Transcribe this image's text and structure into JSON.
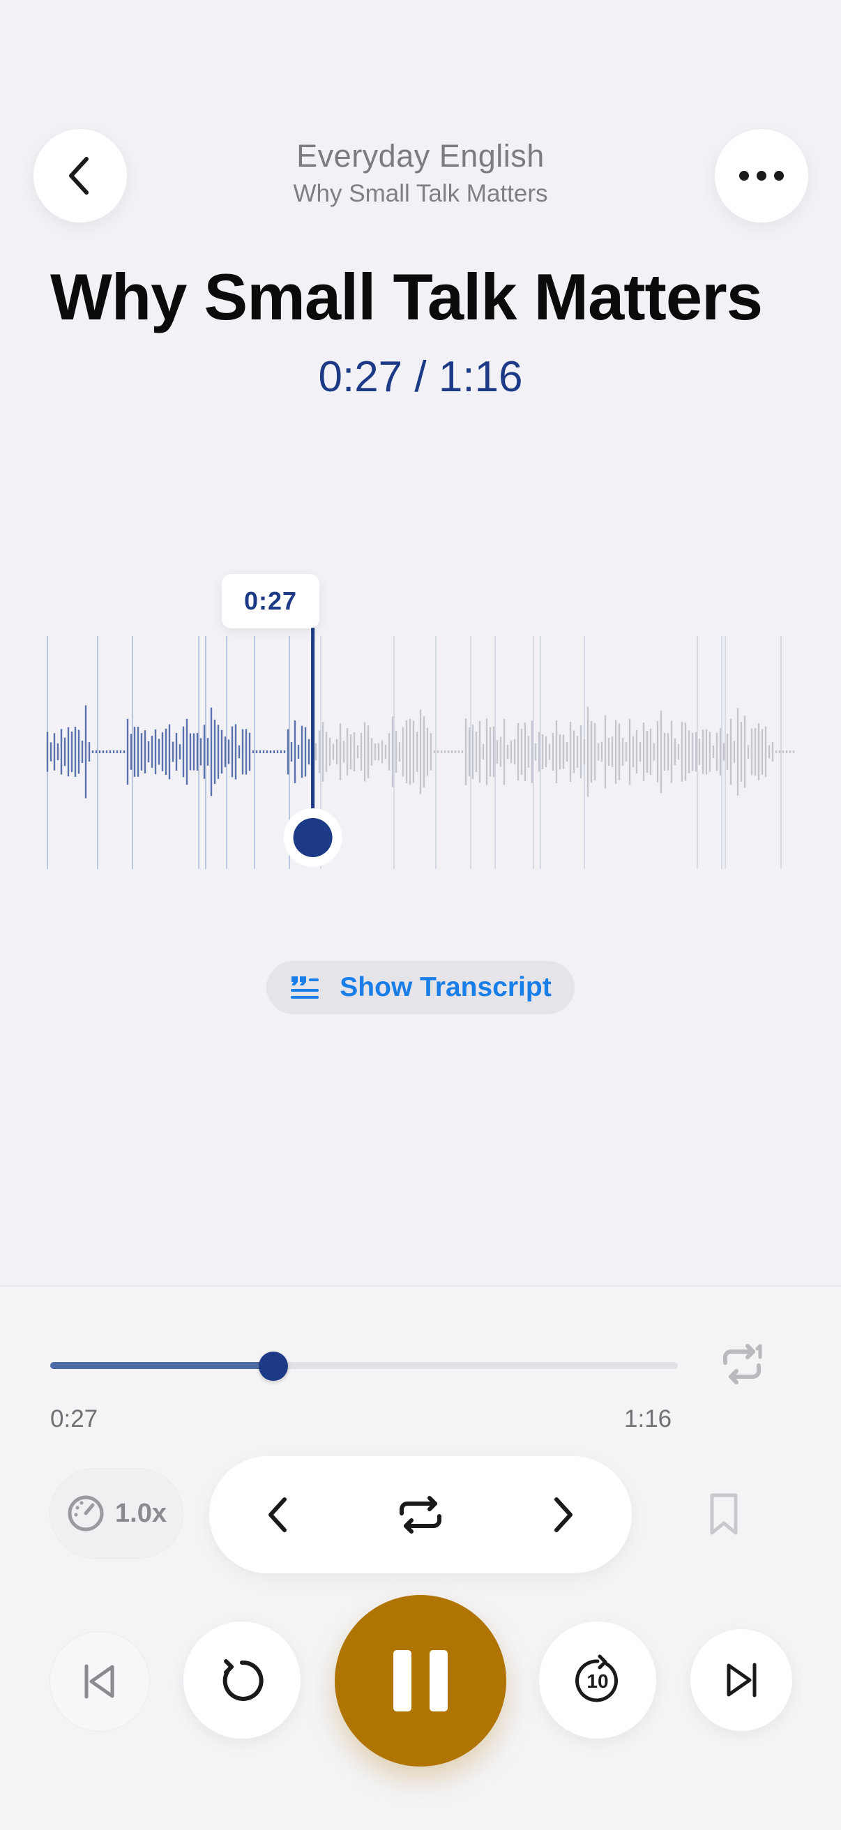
{
  "header": {
    "album": "Everyday English",
    "track": "Why Small Talk Matters"
  },
  "main": {
    "title": "Why Small Talk Matters",
    "time_display": "0:27 / 1:16",
    "tooltip_time": "0:27",
    "transcript_label": "Show Transcript",
    "playback_progress": 0.355
  },
  "player": {
    "current_time": "0:27",
    "total_time": "1:16",
    "speed": "1.0x",
    "progress": 0.355
  },
  "icons": {
    "back": "chevron-left-icon",
    "more": "ellipsis-icon",
    "transcript": "quote-lines-icon",
    "repeat_one": "repeat-one-icon",
    "speed": "speedometer-icon",
    "prev_sentence": "chevron-left-icon",
    "loop": "repeat-icon",
    "next_sentence": "chevron-right-icon",
    "bookmark": "bookmark-icon",
    "skip_start": "skip-previous-icon",
    "replay": "replay-icon",
    "pause": "pause-icon",
    "forward10": "forward-10-icon",
    "skip_end": "skip-next-icon"
  },
  "colors": {
    "accent": "#1c3a86",
    "play_button": "#b07403",
    "link": "#1a7ee8",
    "background": "#f2f2f6"
  }
}
